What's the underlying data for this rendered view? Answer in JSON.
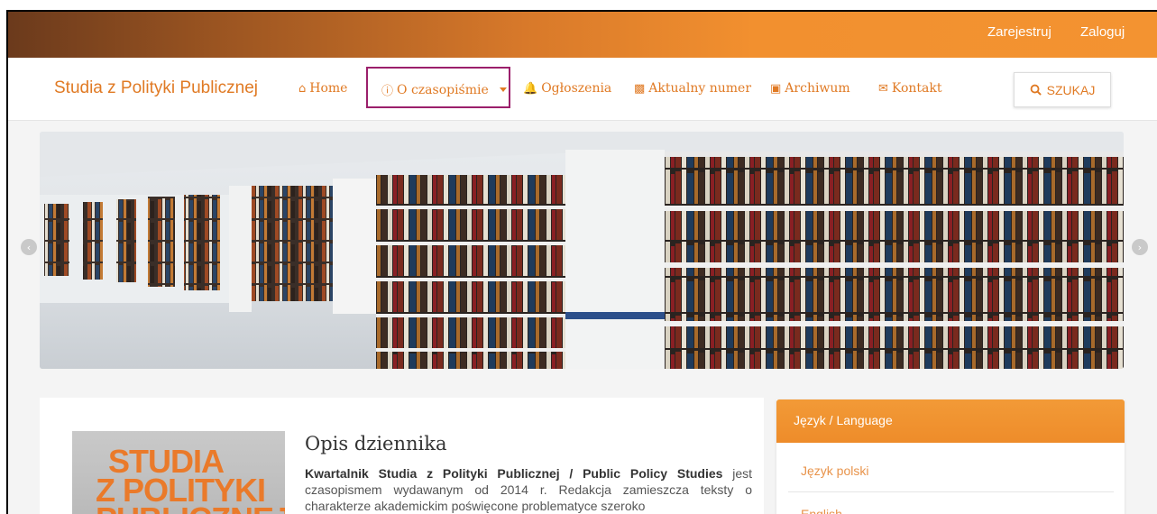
{
  "topbar": {
    "register": "Zarejestruj",
    "login": "Zaloguj"
  },
  "navbar": {
    "brand": "Studia z Polityki Publicznej",
    "items": [
      {
        "label": "Home",
        "icon": "home-icon"
      },
      {
        "label": "O czasopiśmie",
        "icon": "info-circle-icon"
      },
      {
        "label": "Ogłoszenia",
        "icon": "bell-icon"
      },
      {
        "label": "Aktualny numer",
        "icon": "book-icon"
      },
      {
        "label": "Archiwum",
        "icon": "archive-icon"
      },
      {
        "label": "Kontakt",
        "icon": "envelope-icon"
      }
    ],
    "search_label": "SZUKAJ"
  },
  "main": {
    "cover_text": [
      "STUDIA",
      "Z POLITYKI",
      "PUBLICZNEJ"
    ],
    "title": "Opis dziennika",
    "intro_bold": "Kwartalnik Studia z Polityki Publicznej / Public Policy Studies",
    "intro_rest": " jest czasopismem wydawanym od 2014 r. Redakcja zamieszcza teksty o charakterze akademickim poświęcone problematyce szeroko"
  },
  "sidebar": {
    "language_title": "Język / Language",
    "languages": [
      "Język polski",
      "English"
    ]
  },
  "colors": {
    "accent": "#e07a24",
    "active_border": "#9b1f6b",
    "topbar_start": "#6b3a1c",
    "topbar_end": "#f39331"
  }
}
